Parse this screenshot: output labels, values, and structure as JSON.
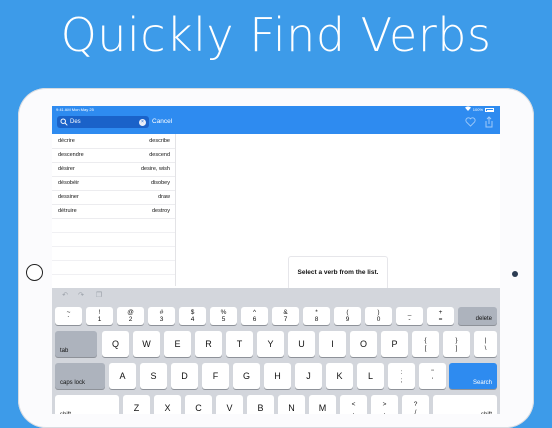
{
  "headline": "Quickly Find Verbs",
  "status": {
    "time": "9:41 AM Mon May 25",
    "battery": "100%"
  },
  "search": {
    "query": "Des",
    "cancel_label": "Cancel"
  },
  "verbs": [
    {
      "french": "décrire",
      "english": "describe"
    },
    {
      "french": "descendre",
      "english": "descend"
    },
    {
      "french": "désirer",
      "english": "desire, wish"
    },
    {
      "french": "désobéir",
      "english": "disobey"
    },
    {
      "french": "dessiner",
      "english": "draw"
    },
    {
      "french": "détruire",
      "english": "destroy"
    }
  ],
  "detail": {
    "placeholder": "Select a verb from the list."
  },
  "keyboard": {
    "row1": [
      {
        "t": "~",
        "b": "`"
      },
      {
        "t": "!",
        "b": "1"
      },
      {
        "t": "@",
        "b": "2"
      },
      {
        "t": "#",
        "b": "3"
      },
      {
        "t": "$",
        "b": "4"
      },
      {
        "t": "%",
        "b": "5"
      },
      {
        "t": "^",
        "b": "6"
      },
      {
        "t": "&",
        "b": "7"
      },
      {
        "t": "*",
        "b": "8"
      },
      {
        "t": "(",
        "b": "9"
      },
      {
        "t": ")",
        "b": "0"
      },
      {
        "t": "_",
        "b": "-"
      },
      {
        "t": "+",
        "b": "="
      }
    ],
    "delete_label": "delete",
    "tab_label": "tab",
    "row2": [
      "Q",
      "W",
      "E",
      "R",
      "T",
      "Y",
      "U",
      "I",
      "O",
      "P"
    ],
    "row2_extra": [
      {
        "t": "{",
        "b": "["
      },
      {
        "t": "}",
        "b": "]"
      },
      {
        "t": "|",
        "b": "\\"
      }
    ],
    "caps_label": "caps lock",
    "row3": [
      "A",
      "S",
      "D",
      "F",
      "G",
      "H",
      "J",
      "K",
      "L"
    ],
    "row3_extra": [
      {
        "t": ":",
        "b": ";"
      },
      {
        "t": "\"",
        "b": "'"
      }
    ],
    "search_label": "Search",
    "shift_label": "shift",
    "row4": [
      "Z",
      "X",
      "C",
      "V",
      "B",
      "N",
      "M"
    ],
    "row4_extra": [
      {
        "t": "<",
        "b": ","
      },
      {
        "t": ">",
        "b": "."
      },
      {
        "t": "?",
        "b": "/"
      }
    ]
  },
  "colors": {
    "accent": "#2e8bf0",
    "background": "#3d9be9",
    "search_field": "#1a62c9"
  },
  "icons": [
    "search-icon",
    "clear-icon",
    "heart-icon",
    "share-icon",
    "undo-icon",
    "redo-icon",
    "paste-icon"
  ]
}
